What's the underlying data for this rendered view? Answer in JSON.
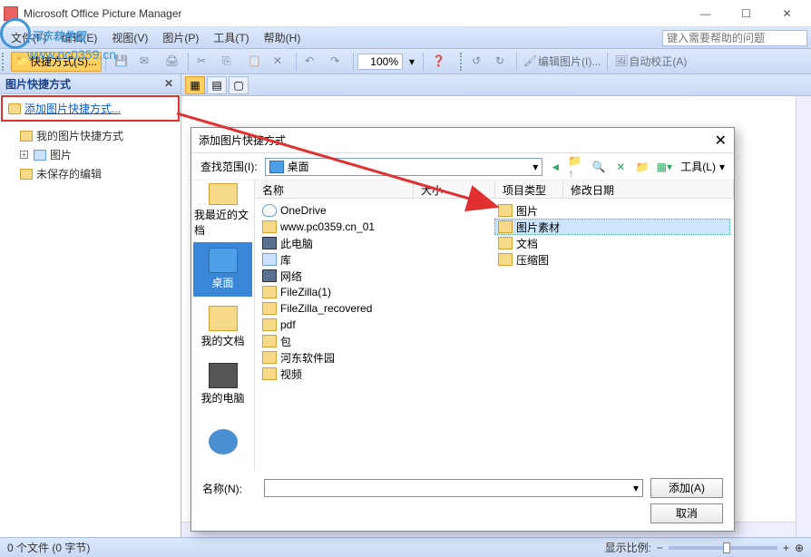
{
  "titlebar": {
    "title": "Microsoft Office Picture Manager"
  },
  "watermark": {
    "text": "河东软件园",
    "url": "www.pc0359.cn"
  },
  "menu": {
    "file": "文件(F)",
    "edit": "编辑(E)",
    "view": "视图(V)",
    "image": "图片(P)",
    "tools": "工具(T)",
    "help": "帮助(H)",
    "search_placeholder": "键入需要帮助的问题"
  },
  "toolbar": {
    "shortcut": "快捷方式(S)...",
    "zoom": "100%",
    "edit_image": "编辑图片(I)...",
    "auto_correct": "自动校正(A)"
  },
  "panel": {
    "title": "图片快捷方式",
    "add_shortcut": "添加图片快捷方式...",
    "tree": {
      "my_shortcuts": "我的图片快捷方式",
      "pictures": "图片",
      "unsaved": "未保存的编辑"
    }
  },
  "dialog": {
    "title": "添加图片快捷方式",
    "lookin": "查找范围(I):",
    "lookin_value": "桌面",
    "tools_menu": "工具(L)",
    "columns": {
      "name": "名称",
      "size": "大小",
      "type": "项目类型",
      "date": "修改日期"
    },
    "places": {
      "recent": "我最近的文档",
      "desktop": "桌面",
      "mydocs": "我的文档",
      "computer": "我的电脑"
    },
    "left_files": [
      {
        "icon": "cloud",
        "name": "OneDrive"
      },
      {
        "icon": "folder",
        "name": "www.pc0359.cn_01"
      },
      {
        "icon": "pc",
        "name": "此电脑"
      },
      {
        "icon": "lib",
        "name": "库"
      },
      {
        "icon": "net",
        "name": "网络"
      },
      {
        "icon": "folder",
        "name": "FileZilla(1)"
      },
      {
        "icon": "folder",
        "name": "FileZilla_recovered"
      },
      {
        "icon": "folder",
        "name": "pdf"
      },
      {
        "icon": "folder",
        "name": "包"
      },
      {
        "icon": "folder",
        "name": "河东软件园"
      },
      {
        "icon": "folder",
        "name": "视频"
      }
    ],
    "right_files": [
      {
        "icon": "folder",
        "name": "图片",
        "sel": false
      },
      {
        "icon": "folder",
        "name": "图片素材",
        "sel": true
      },
      {
        "icon": "folder",
        "name": "文档",
        "sel": false
      },
      {
        "icon": "folder",
        "name": "压缩图",
        "sel": false
      }
    ],
    "name_label": "名称(N):",
    "name_value": "",
    "add_btn": "添加(A)",
    "cancel_btn": "取消"
  },
  "statusbar": {
    "files": "0 个文件 (0 字节)",
    "zoom_label": "显示比例:"
  }
}
